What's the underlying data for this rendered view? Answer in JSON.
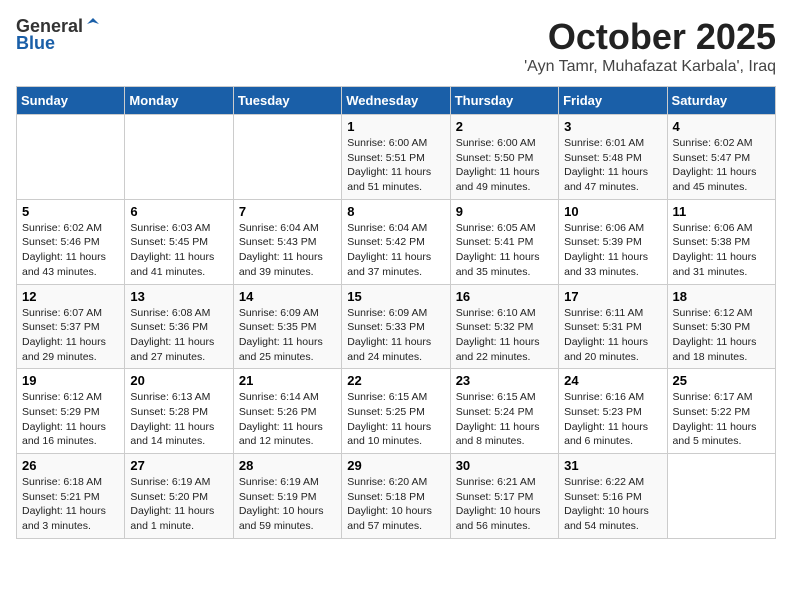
{
  "logo": {
    "general": "General",
    "blue": "Blue"
  },
  "header": {
    "month": "October 2025",
    "location": "'Ayn Tamr, Muhafazat Karbala', Iraq"
  },
  "days_of_week": [
    "Sunday",
    "Monday",
    "Tuesday",
    "Wednesday",
    "Thursday",
    "Friday",
    "Saturday"
  ],
  "weeks": [
    [
      {
        "day": "",
        "info": ""
      },
      {
        "day": "",
        "info": ""
      },
      {
        "day": "",
        "info": ""
      },
      {
        "day": "1",
        "info": "Sunrise: 6:00 AM\nSunset: 5:51 PM\nDaylight: 11 hours\nand 51 minutes."
      },
      {
        "day": "2",
        "info": "Sunrise: 6:00 AM\nSunset: 5:50 PM\nDaylight: 11 hours\nand 49 minutes."
      },
      {
        "day": "3",
        "info": "Sunrise: 6:01 AM\nSunset: 5:48 PM\nDaylight: 11 hours\nand 47 minutes."
      },
      {
        "day": "4",
        "info": "Sunrise: 6:02 AM\nSunset: 5:47 PM\nDaylight: 11 hours\nand 45 minutes."
      }
    ],
    [
      {
        "day": "5",
        "info": "Sunrise: 6:02 AM\nSunset: 5:46 PM\nDaylight: 11 hours\nand 43 minutes."
      },
      {
        "day": "6",
        "info": "Sunrise: 6:03 AM\nSunset: 5:45 PM\nDaylight: 11 hours\nand 41 minutes."
      },
      {
        "day": "7",
        "info": "Sunrise: 6:04 AM\nSunset: 5:43 PM\nDaylight: 11 hours\nand 39 minutes."
      },
      {
        "day": "8",
        "info": "Sunrise: 6:04 AM\nSunset: 5:42 PM\nDaylight: 11 hours\nand 37 minutes."
      },
      {
        "day": "9",
        "info": "Sunrise: 6:05 AM\nSunset: 5:41 PM\nDaylight: 11 hours\nand 35 minutes."
      },
      {
        "day": "10",
        "info": "Sunrise: 6:06 AM\nSunset: 5:39 PM\nDaylight: 11 hours\nand 33 minutes."
      },
      {
        "day": "11",
        "info": "Sunrise: 6:06 AM\nSunset: 5:38 PM\nDaylight: 11 hours\nand 31 minutes."
      }
    ],
    [
      {
        "day": "12",
        "info": "Sunrise: 6:07 AM\nSunset: 5:37 PM\nDaylight: 11 hours\nand 29 minutes."
      },
      {
        "day": "13",
        "info": "Sunrise: 6:08 AM\nSunset: 5:36 PM\nDaylight: 11 hours\nand 27 minutes."
      },
      {
        "day": "14",
        "info": "Sunrise: 6:09 AM\nSunset: 5:35 PM\nDaylight: 11 hours\nand 25 minutes."
      },
      {
        "day": "15",
        "info": "Sunrise: 6:09 AM\nSunset: 5:33 PM\nDaylight: 11 hours\nand 24 minutes."
      },
      {
        "day": "16",
        "info": "Sunrise: 6:10 AM\nSunset: 5:32 PM\nDaylight: 11 hours\nand 22 minutes."
      },
      {
        "day": "17",
        "info": "Sunrise: 6:11 AM\nSunset: 5:31 PM\nDaylight: 11 hours\nand 20 minutes."
      },
      {
        "day": "18",
        "info": "Sunrise: 6:12 AM\nSunset: 5:30 PM\nDaylight: 11 hours\nand 18 minutes."
      }
    ],
    [
      {
        "day": "19",
        "info": "Sunrise: 6:12 AM\nSunset: 5:29 PM\nDaylight: 11 hours\nand 16 minutes."
      },
      {
        "day": "20",
        "info": "Sunrise: 6:13 AM\nSunset: 5:28 PM\nDaylight: 11 hours\nand 14 minutes."
      },
      {
        "day": "21",
        "info": "Sunrise: 6:14 AM\nSunset: 5:26 PM\nDaylight: 11 hours\nand 12 minutes."
      },
      {
        "day": "22",
        "info": "Sunrise: 6:15 AM\nSunset: 5:25 PM\nDaylight: 11 hours\nand 10 minutes."
      },
      {
        "day": "23",
        "info": "Sunrise: 6:15 AM\nSunset: 5:24 PM\nDaylight: 11 hours\nand 8 minutes."
      },
      {
        "day": "24",
        "info": "Sunrise: 6:16 AM\nSunset: 5:23 PM\nDaylight: 11 hours\nand 6 minutes."
      },
      {
        "day": "25",
        "info": "Sunrise: 6:17 AM\nSunset: 5:22 PM\nDaylight: 11 hours\nand 5 minutes."
      }
    ],
    [
      {
        "day": "26",
        "info": "Sunrise: 6:18 AM\nSunset: 5:21 PM\nDaylight: 11 hours\nand 3 minutes."
      },
      {
        "day": "27",
        "info": "Sunrise: 6:19 AM\nSunset: 5:20 PM\nDaylight: 11 hours\nand 1 minute."
      },
      {
        "day": "28",
        "info": "Sunrise: 6:19 AM\nSunset: 5:19 PM\nDaylight: 10 hours\nand 59 minutes."
      },
      {
        "day": "29",
        "info": "Sunrise: 6:20 AM\nSunset: 5:18 PM\nDaylight: 10 hours\nand 57 minutes."
      },
      {
        "day": "30",
        "info": "Sunrise: 6:21 AM\nSunset: 5:17 PM\nDaylight: 10 hours\nand 56 minutes."
      },
      {
        "day": "31",
        "info": "Sunrise: 6:22 AM\nSunset: 5:16 PM\nDaylight: 10 hours\nand 54 minutes."
      },
      {
        "day": "",
        "info": ""
      }
    ]
  ]
}
